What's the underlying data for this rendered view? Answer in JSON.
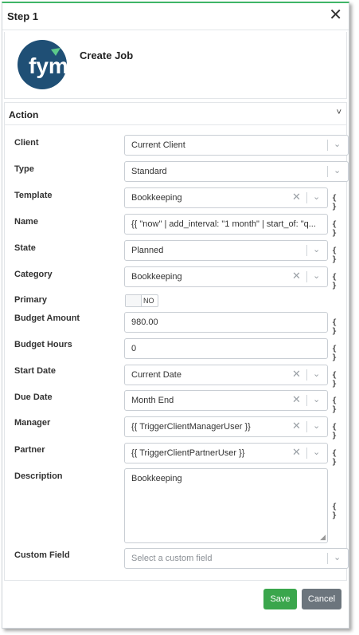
{
  "header": {
    "title": "Step 1",
    "close_glyph": "✕"
  },
  "job": {
    "title": "Create Job",
    "logo_text": "fym"
  },
  "section": {
    "title": "Action",
    "chevron": "˅"
  },
  "fields": {
    "client": {
      "label": "Client",
      "value": "Current Client"
    },
    "type": {
      "label": "Type",
      "value": "Standard"
    },
    "template": {
      "label": "Template",
      "value": "Bookkeeping"
    },
    "name": {
      "label": "Name",
      "value": "{{ \"now\" | add_interval: \"1 month\" | start_of: \"q..."
    },
    "state": {
      "label": "State",
      "value": "Planned"
    },
    "category": {
      "label": "Category",
      "value": "Bookkeeping"
    },
    "primary": {
      "label": "Primary",
      "value": "NO"
    },
    "budget_amount": {
      "label": "Budget Amount",
      "value": "980.00"
    },
    "budget_hours": {
      "label": "Budget Hours",
      "value": "0"
    },
    "start_date": {
      "label": "Start Date",
      "value": "Current Date"
    },
    "due_date": {
      "label": "Due Date",
      "value": "Month End"
    },
    "manager": {
      "label": "Manager",
      "value": "{{ TriggerClientManagerUser }}"
    },
    "partner": {
      "label": "Partner",
      "value": "{{ TriggerClientPartnerUser }}"
    },
    "description": {
      "label": "Description",
      "value": "Bookkeeping"
    },
    "custom_field": {
      "label": "Custom Field",
      "placeholder": "Select a custom field"
    }
  },
  "icons": {
    "clear": "✕",
    "dropdown": "⌄",
    "variable": "{ }"
  },
  "buttons": {
    "save": "Save",
    "cancel": "Cancel"
  },
  "colors": {
    "save": "#3aa64c",
    "cancel": "#6c757d",
    "logo_bg": "#1f4f75",
    "accent_top": "#3fb567"
  }
}
